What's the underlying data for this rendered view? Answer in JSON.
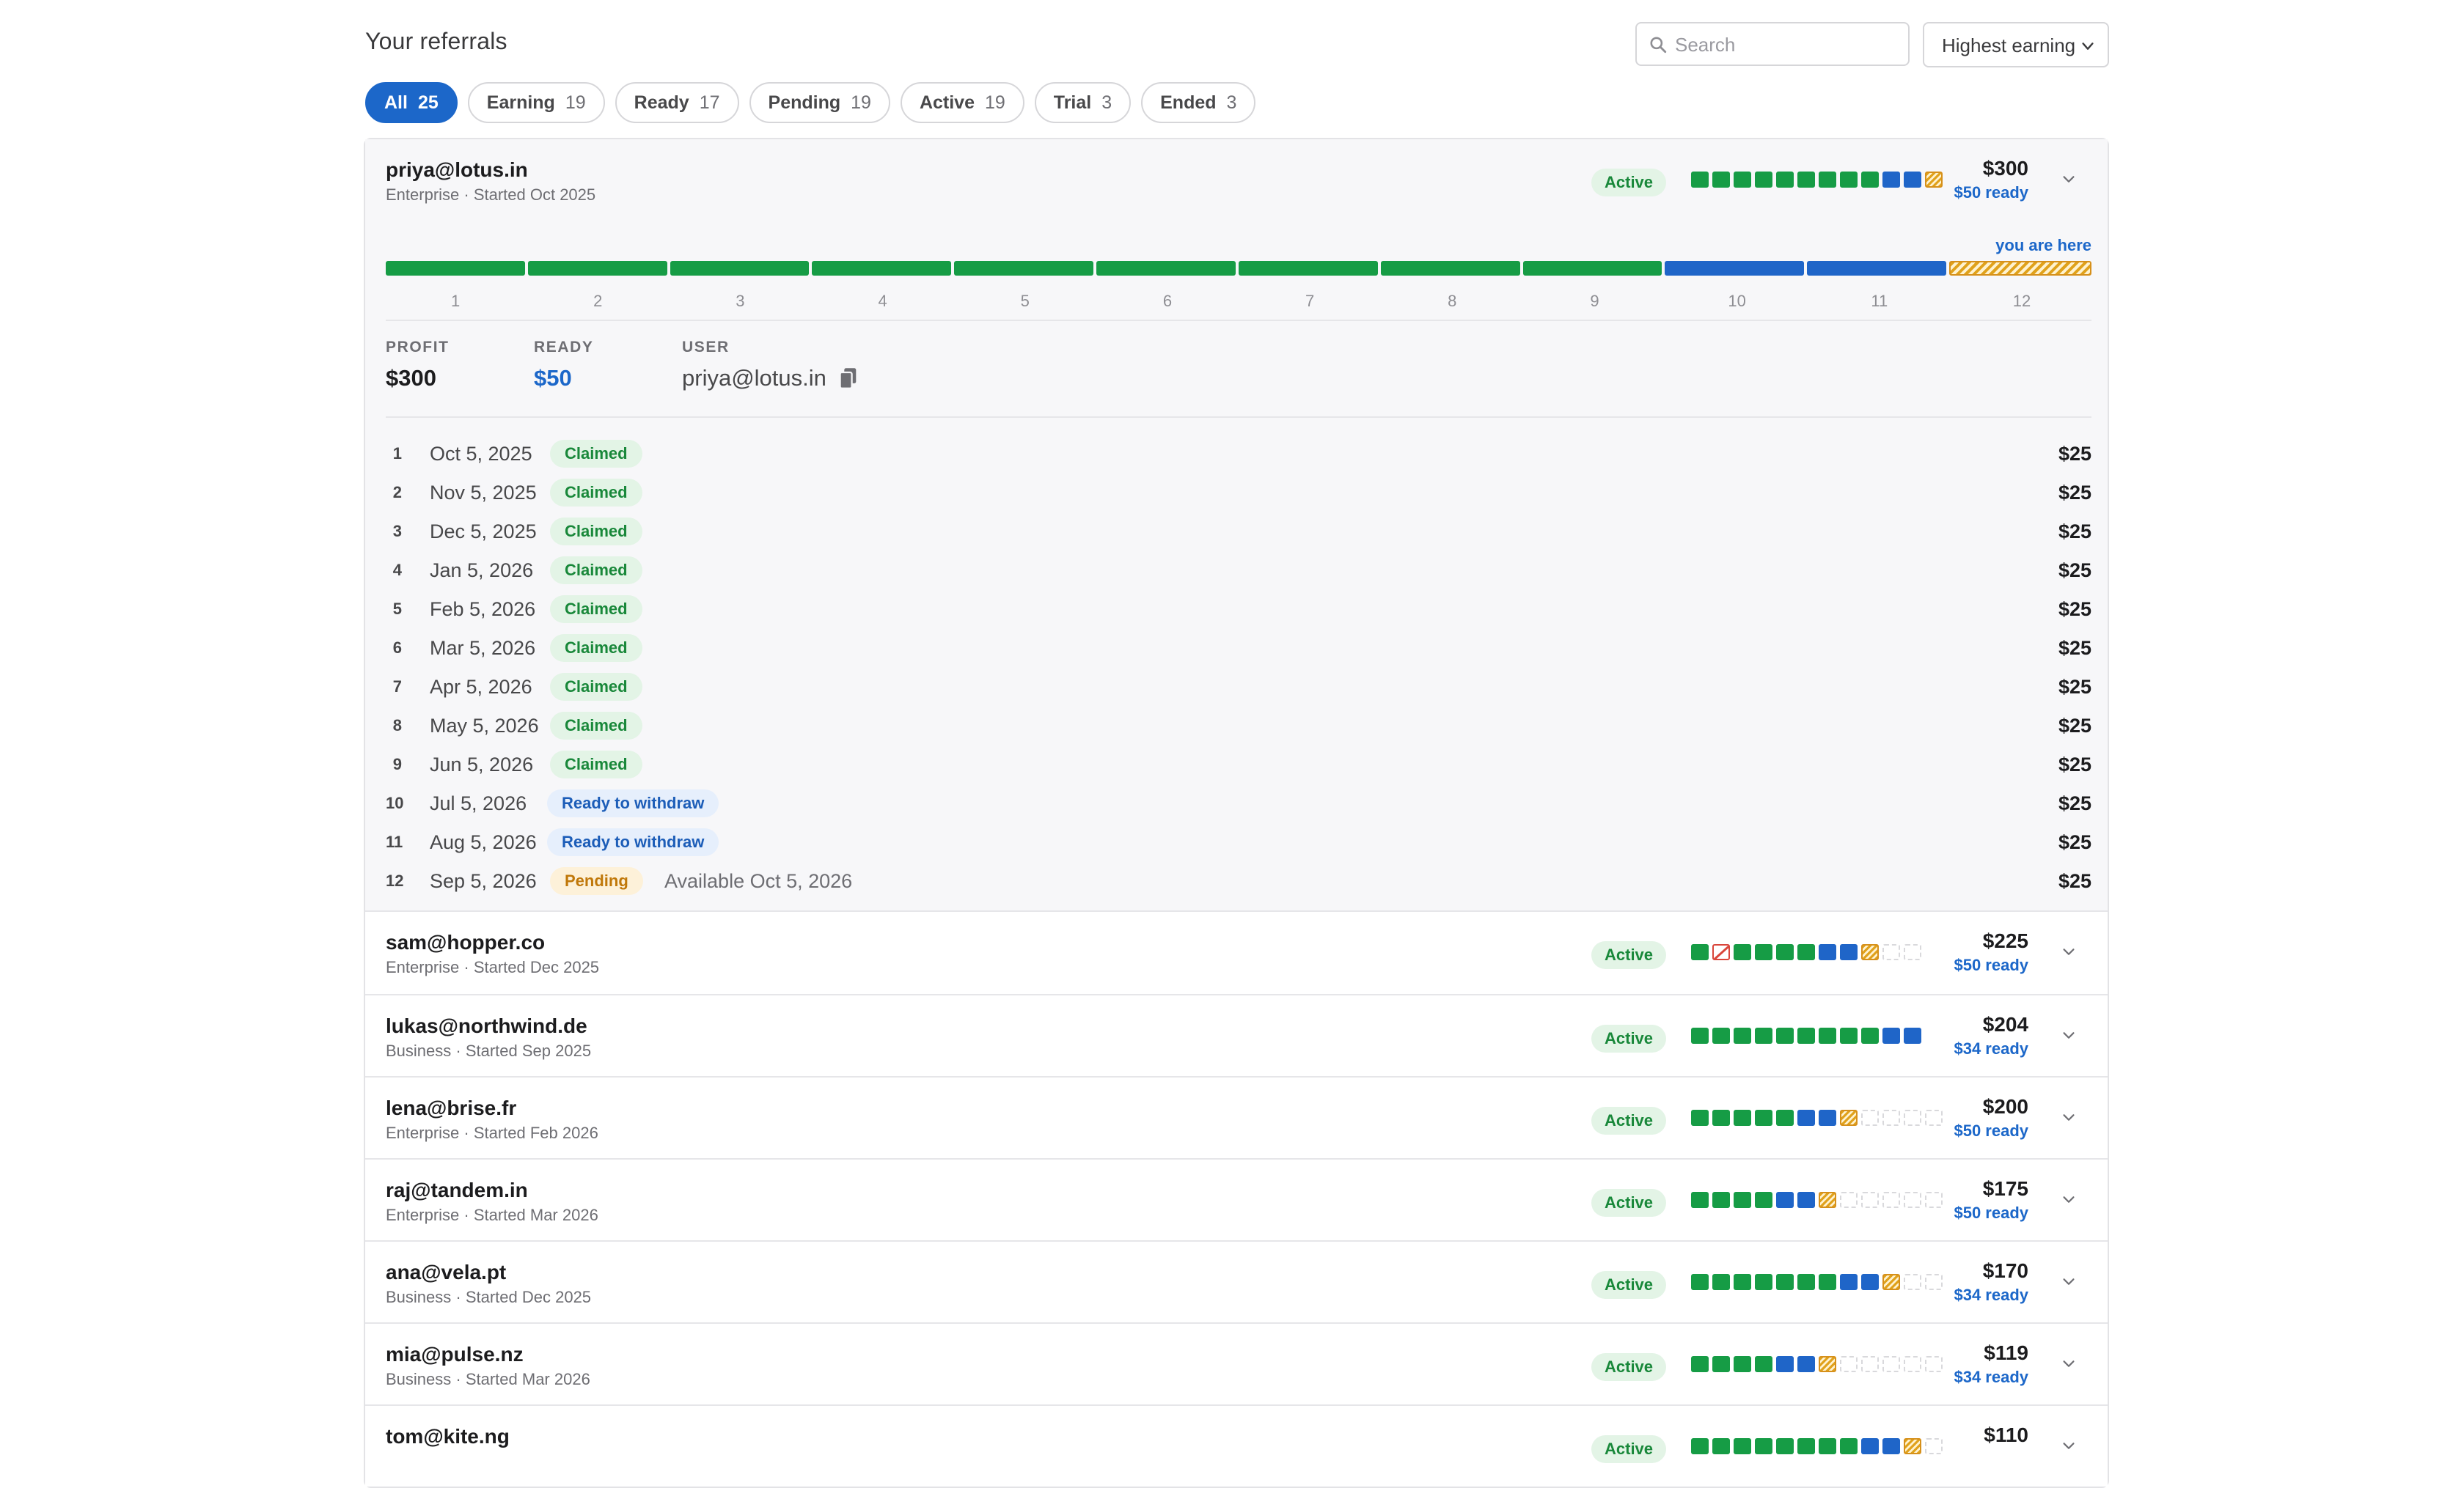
{
  "header": {
    "title": "Your referrals",
    "search_placeholder": "Search",
    "sort_label": "Highest earning"
  },
  "filters": [
    {
      "label": "All",
      "count": "25",
      "active": true
    },
    {
      "label": "Earning",
      "count": "19"
    },
    {
      "label": "Ready",
      "count": "17"
    },
    {
      "label": "Pending",
      "count": "19"
    },
    {
      "label": "Active",
      "count": "19"
    },
    {
      "label": "Trial",
      "count": "3"
    },
    {
      "label": "Ended",
      "count": "3"
    }
  ],
  "icons": {
    "search": "search-icon",
    "chevron": "chevron-down-icon",
    "copy": "copy-icon"
  },
  "colors": {
    "claimed": "#169c45",
    "ready": "#1f65c8",
    "pending": "#e0a21c",
    "missed": "#d9463b",
    "accent": "#1c67c9"
  },
  "expanded": {
    "email": "priya@lotus.in",
    "meta": "Enterprise · Started Oct 2025",
    "status": "Active",
    "total": "$300",
    "ready": "$50 ready",
    "you_are_here": "you are here",
    "segments": [
      "claimed",
      "claimed",
      "claimed",
      "claimed",
      "claimed",
      "claimed",
      "claimed",
      "claimed",
      "claimed",
      "ready",
      "ready",
      "pending"
    ],
    "tick_labels": [
      "1",
      "2",
      "3",
      "4",
      "5",
      "6",
      "7",
      "8",
      "9",
      "10",
      "11",
      "12"
    ],
    "stats": {
      "profit_label": "PROFIT",
      "profit": "$300",
      "ready_label": "READY",
      "ready": "$50",
      "user_label": "USER",
      "user": "priya@lotus.in"
    },
    "payouts": [
      {
        "n": "1",
        "date": "Oct 5, 2025",
        "status": "Claimed",
        "type": "claimed",
        "amount": "$25"
      },
      {
        "n": "2",
        "date": "Nov 5, 2025",
        "status": "Claimed",
        "type": "claimed",
        "amount": "$25"
      },
      {
        "n": "3",
        "date": "Dec 5, 2025",
        "status": "Claimed",
        "type": "claimed",
        "amount": "$25"
      },
      {
        "n": "4",
        "date": "Jan 5, 2026",
        "status": "Claimed",
        "type": "claimed",
        "amount": "$25"
      },
      {
        "n": "5",
        "date": "Feb 5, 2026",
        "status": "Claimed",
        "type": "claimed",
        "amount": "$25"
      },
      {
        "n": "6",
        "date": "Mar 5, 2026",
        "status": "Claimed",
        "type": "claimed",
        "amount": "$25"
      },
      {
        "n": "7",
        "date": "Apr 5, 2026",
        "status": "Claimed",
        "type": "claimed",
        "amount": "$25"
      },
      {
        "n": "8",
        "date": "May 5, 2026",
        "status": "Claimed",
        "type": "claimed",
        "amount": "$25"
      },
      {
        "n": "9",
        "date": "Jun 5, 2026",
        "status": "Claimed",
        "type": "claimed",
        "amount": "$25"
      },
      {
        "n": "10",
        "date": "Jul 5, 2026",
        "status": "Ready to withdraw",
        "type": "ready",
        "amount": "$25"
      },
      {
        "n": "11",
        "date": "Aug 5, 2026",
        "status": "Ready to withdraw",
        "type": "ready",
        "amount": "$25"
      },
      {
        "n": "12",
        "date": "Sep 5, 2026",
        "status": "Pending",
        "type": "pending",
        "note": "Available Oct 5, 2026",
        "amount": "$25"
      }
    ]
  },
  "referrals": [
    {
      "email": "sam@hopper.co",
      "meta": "Enterprise · Started Dec 2025",
      "status": "Active",
      "total": "$225",
      "ready": "$50 ready",
      "months": [
        "claimed",
        "missed",
        "claimed",
        "claimed",
        "claimed",
        "claimed",
        "ready",
        "ready",
        "pending",
        "empty",
        "empty"
      ]
    },
    {
      "email": "lukas@northwind.de",
      "meta": "Business · Started Sep 2025",
      "status": "Active",
      "total": "$204",
      "ready": "$34 ready",
      "months": [
        "claimed",
        "claimed",
        "claimed",
        "claimed",
        "claimed",
        "claimed",
        "claimed",
        "claimed",
        "claimed",
        "ready",
        "ready"
      ]
    },
    {
      "email": "lena@brise.fr",
      "meta": "Enterprise · Started Feb 2026",
      "status": "Active",
      "total": "$200",
      "ready": "$50 ready",
      "months": [
        "claimed",
        "claimed",
        "claimed",
        "claimed",
        "claimed",
        "ready",
        "ready",
        "pending",
        "empty",
        "empty",
        "empty",
        "empty"
      ]
    },
    {
      "email": "raj@tandem.in",
      "meta": "Enterprise · Started Mar 2026",
      "status": "Active",
      "total": "$175",
      "ready": "$50 ready",
      "months": [
        "claimed",
        "claimed",
        "claimed",
        "claimed",
        "ready",
        "ready",
        "pending",
        "empty",
        "empty",
        "empty",
        "empty",
        "empty"
      ]
    },
    {
      "email": "ana@vela.pt",
      "meta": "Business · Started Dec 2025",
      "status": "Active",
      "total": "$170",
      "ready": "$34 ready",
      "months": [
        "claimed",
        "claimed",
        "claimed",
        "claimed",
        "claimed",
        "claimed",
        "claimed",
        "ready",
        "ready",
        "pending",
        "empty",
        "empty"
      ]
    },
    {
      "email": "mia@pulse.nz",
      "meta": "Business · Started Mar 2026",
      "status": "Active",
      "total": "$119",
      "ready": "$34 ready",
      "months": [
        "claimed",
        "claimed",
        "claimed",
        "claimed",
        "ready",
        "ready",
        "pending",
        "empty",
        "empty",
        "empty",
        "empty",
        "empty"
      ]
    },
    {
      "email": "tom@kite.ng",
      "meta": "",
      "status": "Active",
      "total": "$110",
      "ready": "",
      "months": [
        "claimed",
        "claimed",
        "claimed",
        "claimed",
        "claimed",
        "claimed",
        "claimed",
        "claimed",
        "ready",
        "ready",
        "pending",
        "empty"
      ]
    }
  ]
}
